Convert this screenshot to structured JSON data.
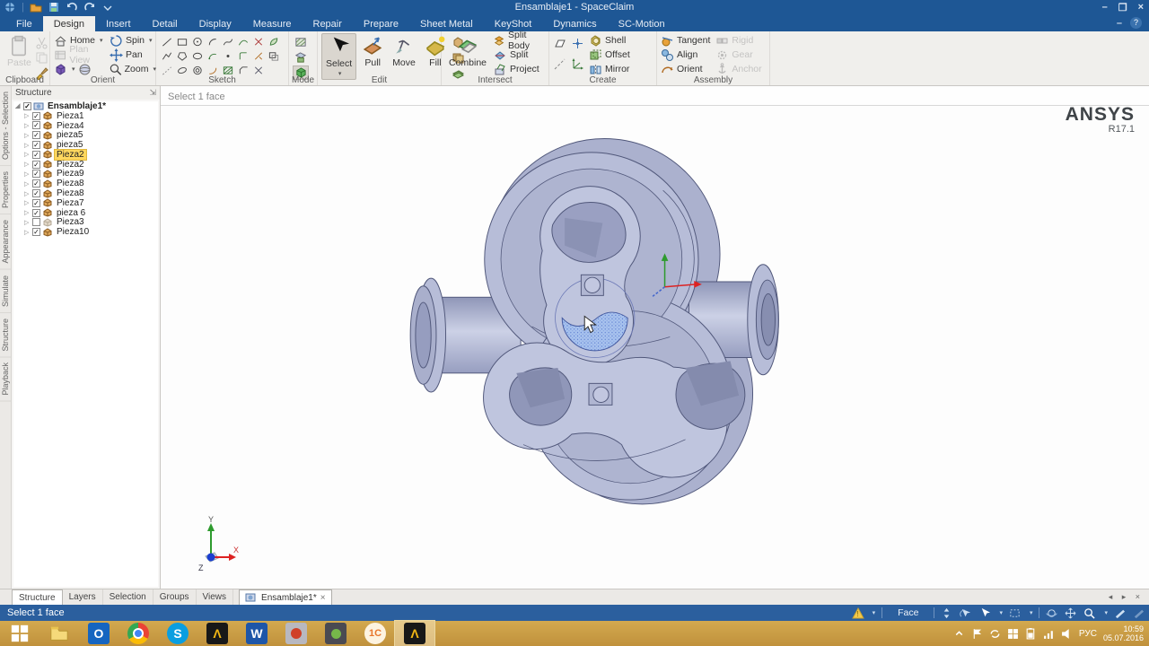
{
  "window": {
    "title": "Ensamblaje1 - SpaceClaim",
    "minimize": "–",
    "restore": "❐",
    "close": "×"
  },
  "menu_tabs": {
    "items": [
      "File",
      "Design",
      "Insert",
      "Detail",
      "Display",
      "Measure",
      "Repair",
      "Prepare",
      "Sheet Metal",
      "KeyShot",
      "Dynamics",
      "SC-Motion"
    ],
    "active": "Design"
  },
  "ribbon": {
    "clipboard": {
      "label": "Clipboard",
      "paste": "Paste"
    },
    "orient": {
      "label": "Orient",
      "home": "Home",
      "plan_view": "Plan View",
      "spin": "Spin",
      "pan": "Pan",
      "zoom": "Zoom"
    },
    "sketch": {
      "label": "Sketch",
      "tools": [
        "line",
        "rect",
        "circle",
        "arc",
        "spline",
        "bend",
        "cross",
        "leaf",
        "pline",
        "poly",
        "ellipse",
        "arc2",
        "point",
        "corner",
        "trim",
        "offset",
        "construction",
        "oval",
        "concentric",
        "sweep",
        "hatch",
        "chamfer",
        "cut"
      ]
    },
    "mode": {
      "label": "Mode",
      "modes": [
        "sketch-mode",
        "section-mode",
        "solid-mode"
      ],
      "active_mode": "solid-mode"
    },
    "edit": {
      "label": "Edit",
      "select": "Select",
      "pull": "Pull",
      "move": "Move",
      "fill": "Fill"
    },
    "intersect": {
      "label": "Intersect",
      "combine": "Combine",
      "split_body": "Split Body",
      "split": "Split",
      "project": "Project"
    },
    "create": {
      "label": "Create",
      "shell": "Shell",
      "offset": "Offset",
      "mirror": "Mirror"
    },
    "assembly": {
      "label": "Assembly",
      "tangent": "Tangent",
      "align": "Align",
      "orient": "Orient",
      "rigid": "Rigid",
      "gear": "Gear",
      "anchor": "Anchor"
    }
  },
  "left_strip": {
    "tabs": [
      "Options - Selection",
      "Properties",
      "Appearance",
      "Simulate",
      "Structure",
      "Playback"
    ]
  },
  "structure_panel": {
    "title": "Structure",
    "root": {
      "label": "Ensamblaje1*",
      "checked": true
    },
    "items": [
      {
        "label": "Pieza1",
        "checked": true,
        "highlighted": false
      },
      {
        "label": "Pieza4",
        "checked": true,
        "highlighted": false
      },
      {
        "label": "pieza5",
        "checked": true,
        "highlighted": false
      },
      {
        "label": "pieza5",
        "checked": true,
        "highlighted": false
      },
      {
        "label": "Pieza2",
        "checked": true,
        "highlighted": true
      },
      {
        "label": "Pieza2",
        "checked": true,
        "highlighted": false
      },
      {
        "label": "Pieza9",
        "checked": true,
        "highlighted": false
      },
      {
        "label": "Pieza8",
        "checked": true,
        "highlighted": false
      },
      {
        "label": "Pieza8",
        "checked": true,
        "highlighted": false
      },
      {
        "label": "Pieza7",
        "checked": true,
        "highlighted": false
      },
      {
        "label": "pieza 6",
        "checked": true,
        "highlighted": false
      },
      {
        "label": "Pieza3",
        "checked": false,
        "highlighted": false
      },
      {
        "label": "Pieza10",
        "checked": true,
        "highlighted": false
      }
    ]
  },
  "viewport": {
    "prompt": "Select 1 face",
    "logo": "ANSYS",
    "logo_version": "R17.1",
    "triad": {
      "x": "X",
      "y": "Y",
      "z": "Z"
    }
  },
  "panel_tabs": {
    "items": [
      "Structure",
      "Layers",
      "Selection",
      "Groups",
      "Views"
    ],
    "active": "Structure"
  },
  "document_tab": {
    "label": "Ensamblaje1*",
    "close": "×"
  },
  "tabstrip_nav": "◂ ▸ ×",
  "status_bar": {
    "message": "Select 1 face",
    "selection_type": "Face"
  },
  "taskbar": {
    "apps": [
      "start",
      "explorer",
      "outlook",
      "chrome",
      "skype",
      "ansys",
      "word",
      "photos",
      "photos-dark",
      "1c",
      "spaceclaim"
    ],
    "active_app": "spaceclaim",
    "tray": {
      "language": "РУС",
      "time": "10:59",
      "date": "05.07.2016"
    }
  },
  "colors": {
    "titlebar": "#1e5795",
    "statusbar": "#2b5f9e",
    "taskbar": "#c99d43",
    "model_body": "#b7bdd8",
    "model_edge": "#50577a",
    "highlight_face": "#a8c3ee",
    "tree_highlight": "#ffd75e",
    "accent_warning": "#f2c94c"
  }
}
